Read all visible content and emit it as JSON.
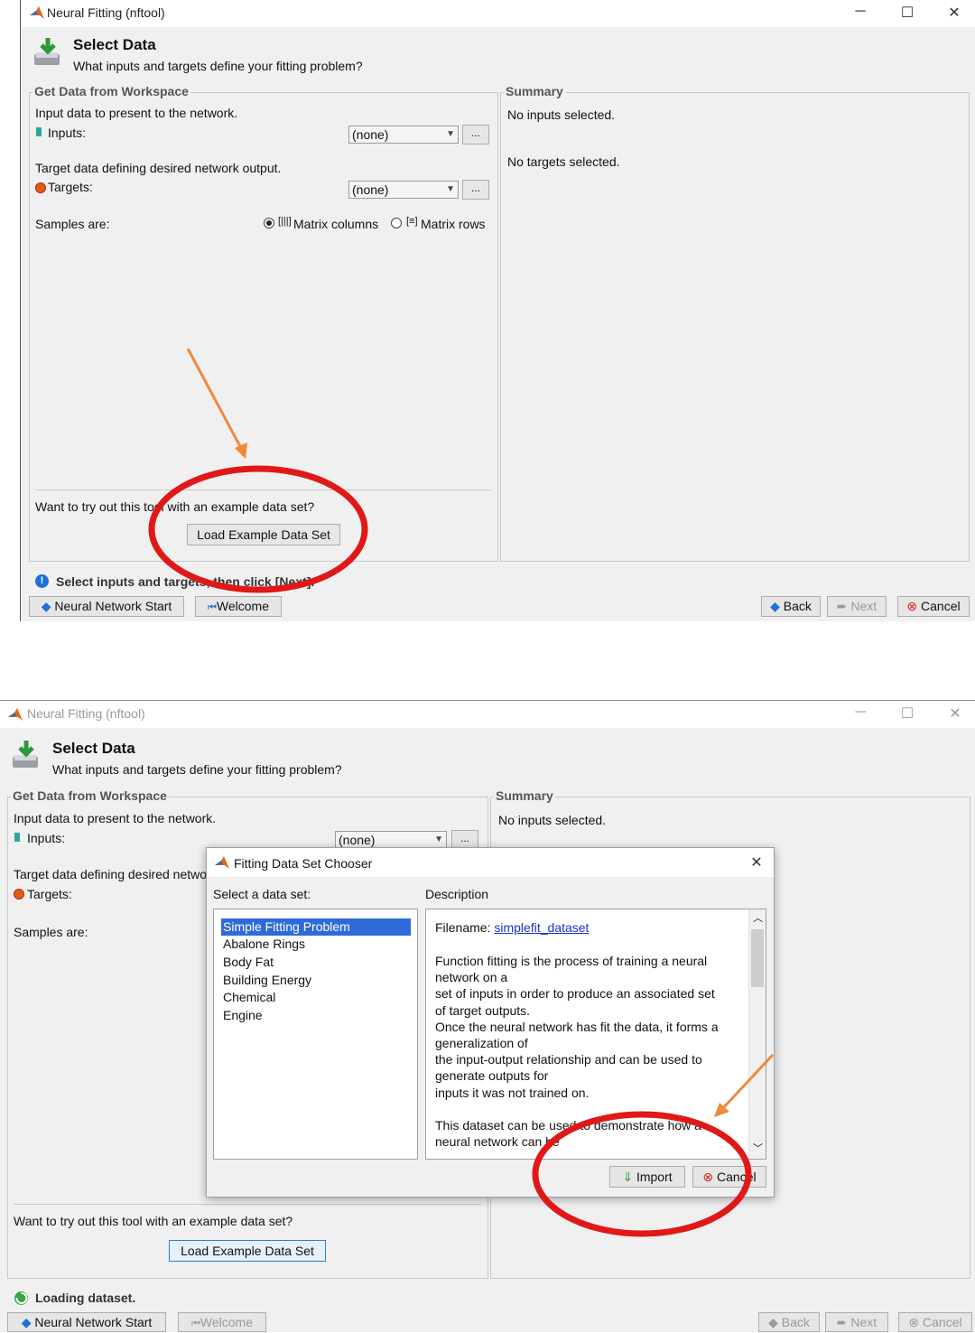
{
  "window1": {
    "title": "Neural Fitting (nftool)",
    "header": {
      "title": "Select Data",
      "subtitle": "What inputs and targets define your fitting problem?"
    },
    "workspace_panel": {
      "label": "Get Data from Workspace",
      "input_text": "Input data to present to the network.",
      "inputs_label": "Inputs:",
      "inputs_value": "(none)",
      "target_text": "Target data defining desired network output.",
      "targets_label": "Targets:",
      "targets_value": "(none)",
      "browse_label": "...",
      "samples_label": "Samples are:",
      "radio_columns": "Matrix columns",
      "radio_rows": "Matrix rows",
      "example_text": "Want to try out this tool with an example data set?",
      "load_button": "Load Example Data Set"
    },
    "summary_panel": {
      "label": "Summary",
      "inputs_text": "No inputs selected.",
      "targets_text": "No targets selected."
    },
    "status": "Select inputs and targets, then click [Next].",
    "footer": {
      "nn_start": "Neural Network Start",
      "welcome": "Welcome",
      "back": "Back",
      "next": "Next",
      "cancel": "Cancel"
    }
  },
  "window2": {
    "title": "Neural Fitting (nftool)",
    "header": {
      "title": "Select Data",
      "subtitle": "What inputs and targets define your fitting problem?"
    },
    "workspace_panel": {
      "label": "Get Data from Workspace",
      "input_text": "Input data to present to the network.",
      "inputs_label": "Inputs:",
      "inputs_value": "(none)",
      "target_text": "Target data defining desired network output.",
      "targets_label": "Targets:",
      "samples_label": "Samples are:",
      "example_text": "Want to try out this tool with an example data set?",
      "load_button": "Load Example Data Set",
      "browse_label": "..."
    },
    "summary_panel": {
      "label": "Summary",
      "inputs_text": "No inputs selected."
    },
    "status": "Loading dataset.",
    "footer": {
      "nn_start": "Neural Network Start",
      "welcome": "Welcome",
      "back": "Back",
      "next": "Next",
      "cancel": "Cancel"
    },
    "dialog": {
      "title": "Fitting Data Set Chooser",
      "select_label": "Select a data set:",
      "description_label": "Description",
      "datasets": [
        "Simple Fitting Problem",
        "Abalone Rings",
        "Body Fat",
        "Building Energy",
        "Chemical",
        "Engine"
      ],
      "selected_index": 0,
      "filename_label": "Filename:",
      "filename_value": "simplefit_dataset",
      "description_text": "Function fitting is the process of training a neural\nnetwork on a\nset of inputs in order to produce an associated set\nof target outputs.\nOnce the neural network has fit the data, it forms a\ngeneralization of\nthe input-output relationship and can be used to\ngenerate outputs for\ninputs it was not trained on.\n\nThis dataset can be used to demonstrate how a\nneural network can be",
      "import_button": "Import",
      "cancel_button": "Cancel"
    }
  },
  "colors": {
    "annotation_arrow": "#f0883a",
    "annotation_circle": "#e01818",
    "selection": "#2f6bd8",
    "matlab_orange": "#e0661a"
  }
}
